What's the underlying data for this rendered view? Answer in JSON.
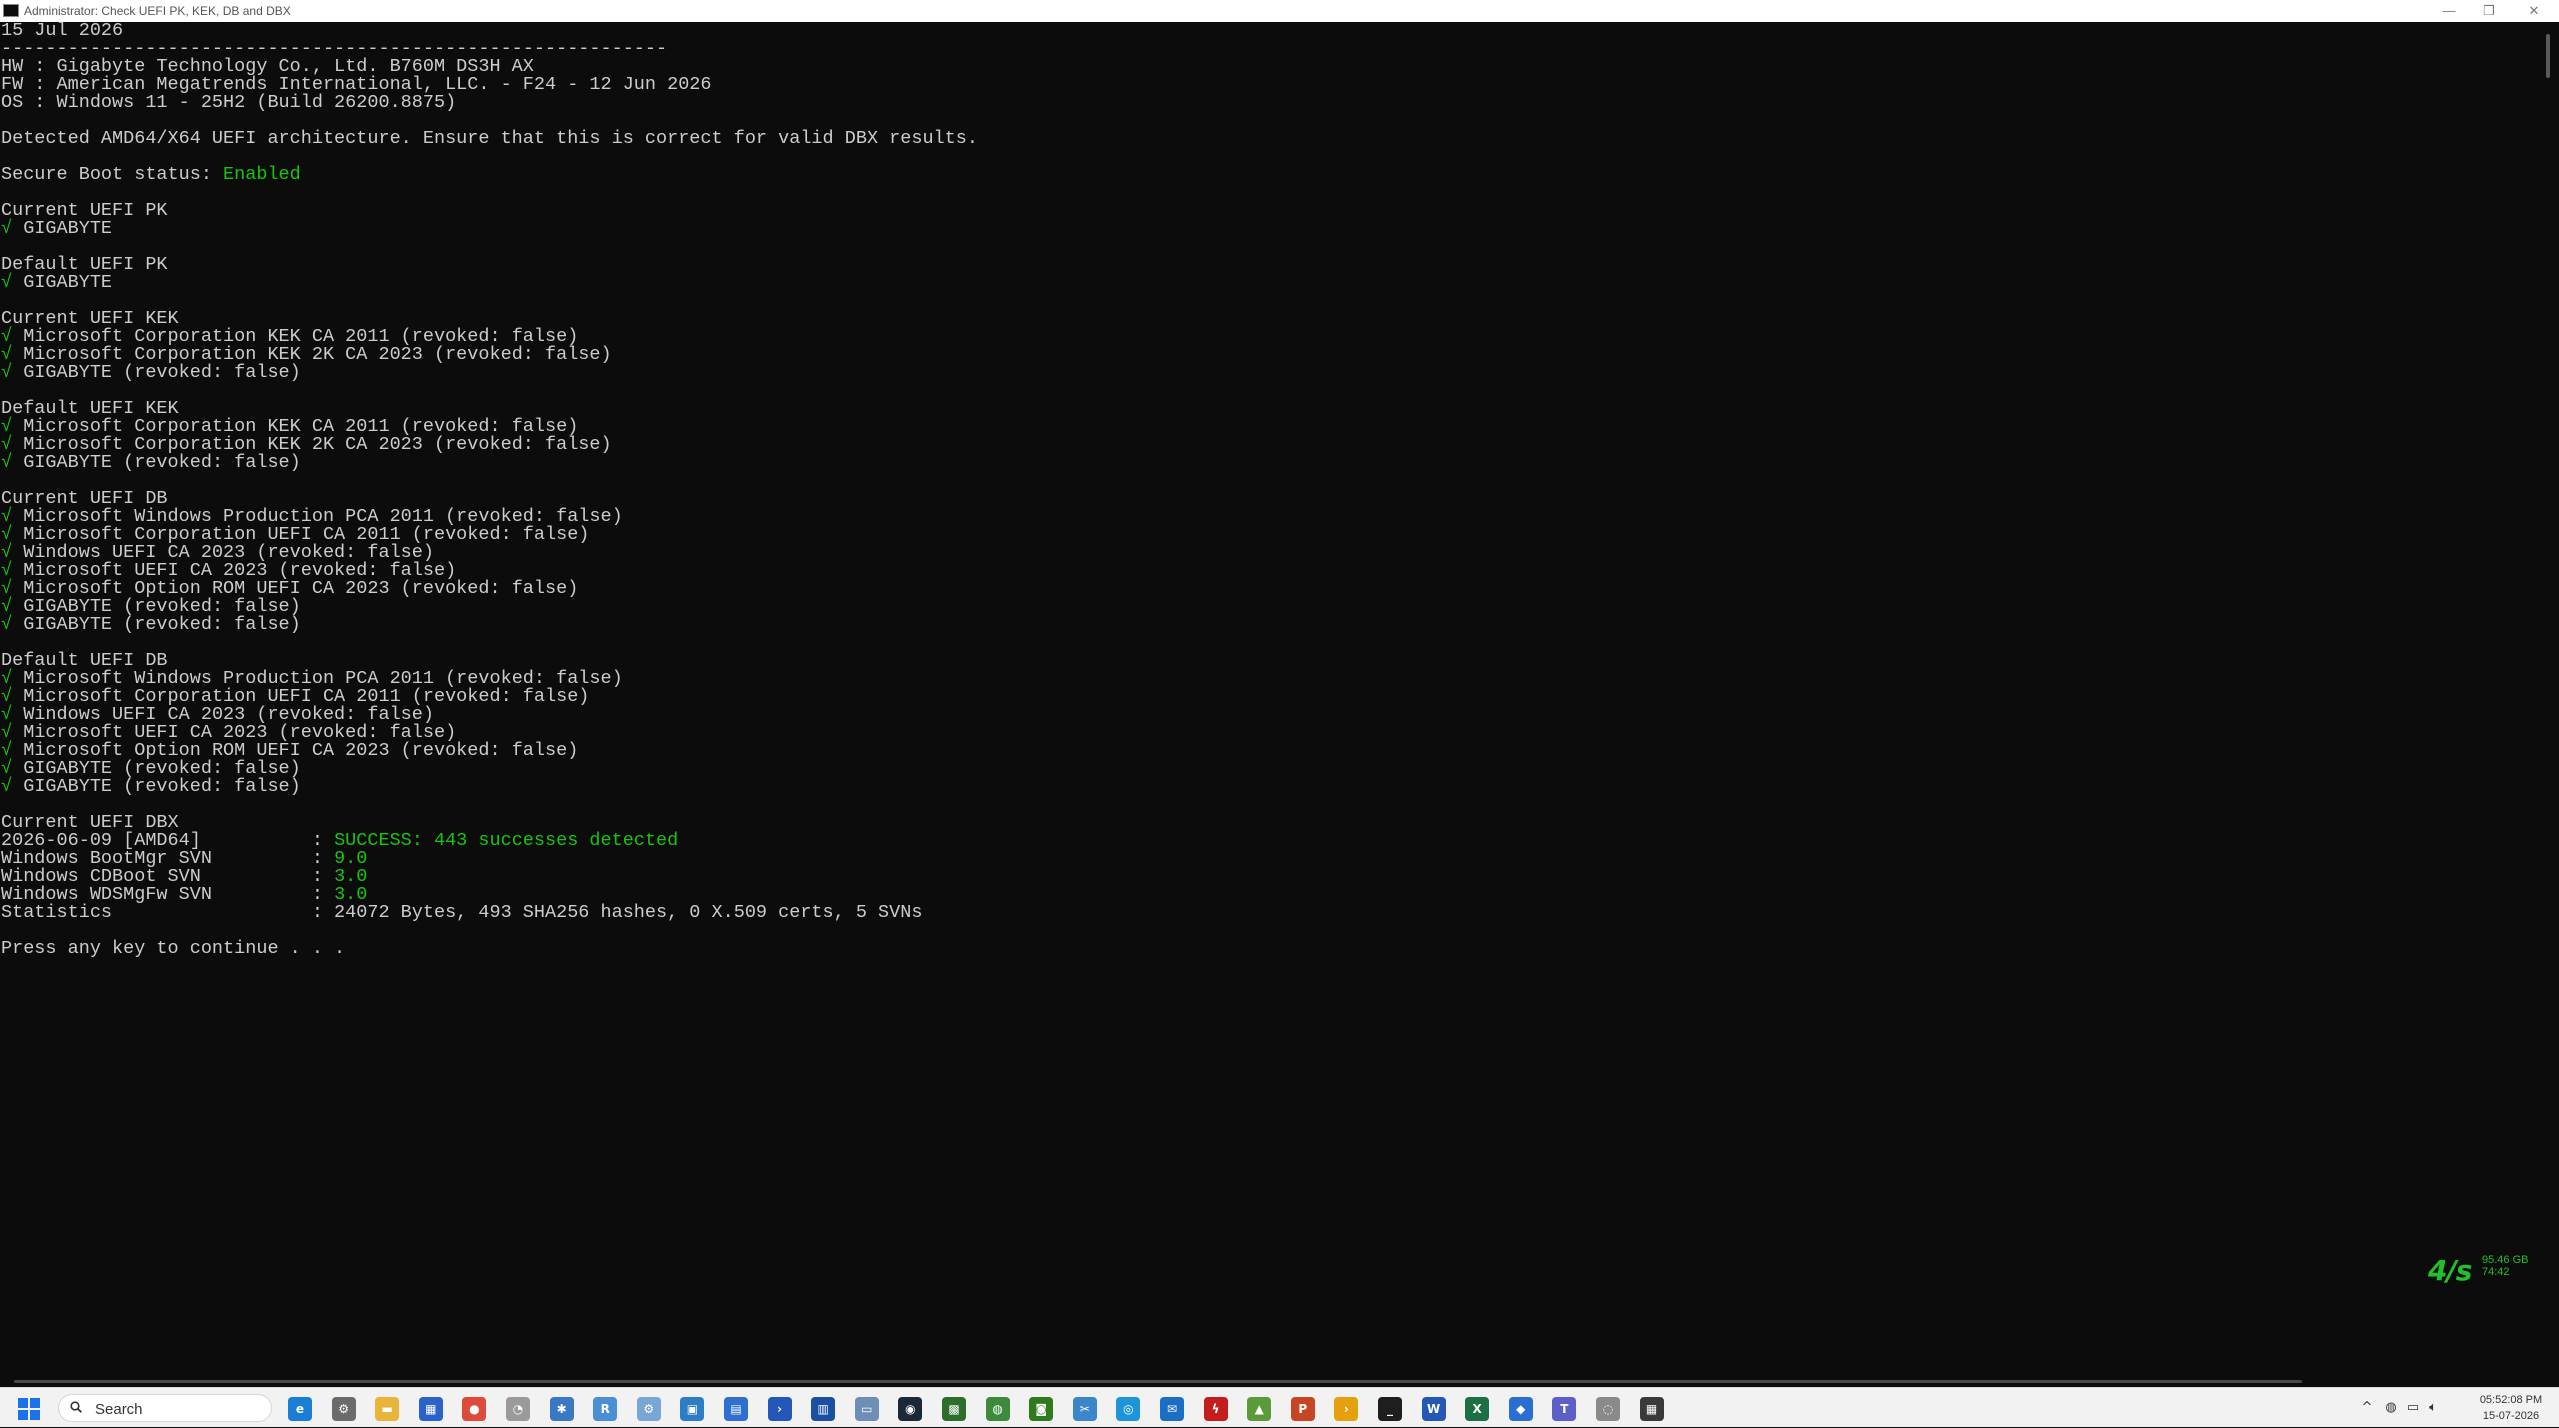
{
  "window": {
    "title": "Administrator: Check UEFI PK, KEK, DB and DBX",
    "minimize": "—",
    "maximize": "❐",
    "close": "✕"
  },
  "console": {
    "lines": [
      [
        {
          "t": "15 Jul 2026"
        }
      ],
      [
        {
          "t": "------------------------------------------------------------"
        }
      ],
      [
        {
          "t": "HW : Gigabyte Technology Co., Ltd. B760M DS3H AX"
        }
      ],
      [
        {
          "t": "FW : American Megatrends International, LLC. - F24 - 12 Jun 2026"
        }
      ],
      [
        {
          "t": "OS : Windows 11 - 25H2 (Build 26200.8875)"
        }
      ],
      [],
      [
        {
          "t": "Detected AMD64/X64 UEFI architecture. Ensure that this is correct for valid DBX results."
        }
      ],
      [],
      [
        {
          "t": "Secure Boot status: "
        },
        {
          "t": "Enabled",
          "c": "g"
        }
      ],
      [],
      [
        {
          "t": "Current UEFI PK"
        }
      ],
      [
        {
          "t": "√",
          "c": "check"
        },
        {
          "t": " GIGABYTE"
        }
      ],
      [],
      [
        {
          "t": "Default UEFI PK"
        }
      ],
      [
        {
          "t": "√",
          "c": "check"
        },
        {
          "t": " GIGABYTE"
        }
      ],
      [],
      [
        {
          "t": "Current UEFI KEK"
        }
      ],
      [
        {
          "t": "√",
          "c": "check"
        },
        {
          "t": " Microsoft Corporation KEK CA 2011 (revoked: false)"
        }
      ],
      [
        {
          "t": "√",
          "c": "check"
        },
        {
          "t": " Microsoft Corporation KEK 2K CA 2023 (revoked: false)"
        }
      ],
      [
        {
          "t": "√",
          "c": "check"
        },
        {
          "t": " GIGABYTE (revoked: false)"
        }
      ],
      [],
      [
        {
          "t": "Default UEFI KEK"
        }
      ],
      [
        {
          "t": "√",
          "c": "check"
        },
        {
          "t": " Microsoft Corporation KEK CA 2011 (revoked: false)"
        }
      ],
      [
        {
          "t": "√",
          "c": "check"
        },
        {
          "t": " Microsoft Corporation KEK 2K CA 2023 (revoked: false)"
        }
      ],
      [
        {
          "t": "√",
          "c": "check"
        },
        {
          "t": " GIGABYTE (revoked: false)"
        }
      ],
      [],
      [
        {
          "t": "Current UEFI DB"
        }
      ],
      [
        {
          "t": "√",
          "c": "check"
        },
        {
          "t": " Microsoft Windows Production PCA 2011 (revoked: false)"
        }
      ],
      [
        {
          "t": "√",
          "c": "check"
        },
        {
          "t": " Microsoft Corporation UEFI CA 2011 (revoked: false)"
        }
      ],
      [
        {
          "t": "√",
          "c": "check"
        },
        {
          "t": " Windows UEFI CA 2023 (revoked: false)"
        }
      ],
      [
        {
          "t": "√",
          "c": "check"
        },
        {
          "t": " Microsoft UEFI CA 2023 (revoked: false)"
        }
      ],
      [
        {
          "t": "√",
          "c": "check"
        },
        {
          "t": " Microsoft Option ROM UEFI CA 2023 (revoked: false)"
        }
      ],
      [
        {
          "t": "√",
          "c": "check"
        },
        {
          "t": " GIGABYTE (revoked: false)"
        }
      ],
      [
        {
          "t": "√",
          "c": "check"
        },
        {
          "t": " GIGABYTE (revoked: false)"
        }
      ],
      [],
      [
        {
          "t": "Default UEFI DB"
        }
      ],
      [
        {
          "t": "√",
          "c": "check"
        },
        {
          "t": " Microsoft Windows Production PCA 2011 (revoked: false)"
        }
      ],
      [
        {
          "t": "√",
          "c": "check"
        },
        {
          "t": " Microsoft Corporation UEFI CA 2011 (revoked: false)"
        }
      ],
      [
        {
          "t": "√",
          "c": "check"
        },
        {
          "t": " Windows UEFI CA 2023 (revoked: false)"
        }
      ],
      [
        {
          "t": "√",
          "c": "check"
        },
        {
          "t": " Microsoft UEFI CA 2023 (revoked: false)"
        }
      ],
      [
        {
          "t": "√",
          "c": "check"
        },
        {
          "t": " Microsoft Option ROM UEFI CA 2023 (revoked: false)"
        }
      ],
      [
        {
          "t": "√",
          "c": "check"
        },
        {
          "t": " GIGABYTE (revoked: false)"
        }
      ],
      [
        {
          "t": "√",
          "c": "check"
        },
        {
          "t": " GIGABYTE (revoked: false)"
        }
      ],
      [],
      [
        {
          "t": "Current UEFI DBX"
        }
      ],
      [
        {
          "t": "2026-06-09 [AMD64]          : "
        },
        {
          "t": "SUCCESS: 443 successes detected",
          "c": "g"
        }
      ],
      [
        {
          "t": "Windows BootMgr SVN         : "
        },
        {
          "t": "9.0",
          "c": "g"
        }
      ],
      [
        {
          "t": "Windows CDBoot SVN          : "
        },
        {
          "t": "3.0",
          "c": "g"
        }
      ],
      [
        {
          "t": "Windows WDSMgFw SVN         : "
        },
        {
          "t": "3.0",
          "c": "g"
        }
      ],
      [
        {
          "t": "Statistics                  : 24072 Bytes, 493 SHA256 hashes, 0 X.509 certs, 5 SVNs"
        }
      ],
      [],
      [
        {
          "t": "Press any key to continue . . ."
        }
      ]
    ]
  },
  "overlay": {
    "speed_label": "4/s",
    "line1": "95.46 GB",
    "line2": "74:42"
  },
  "taskbar": {
    "search_placeholder": "Search",
    "apps": [
      {
        "name": "edge-icon",
        "glyph": "e",
        "color": "#1a7fd4"
      },
      {
        "name": "settings-icon",
        "glyph": "⚙",
        "color": "#6b6b6b"
      },
      {
        "name": "file-explorer-icon",
        "glyph": "▬",
        "color": "#e8b53a"
      },
      {
        "name": "store-icon",
        "glyph": "▦",
        "color": "#2a62c9"
      },
      {
        "name": "chrome-icon",
        "glyph": "●",
        "color": "#dd4b39"
      },
      {
        "name": "clock-app-icon",
        "glyph": "◔",
        "color": "#9a9a9a"
      },
      {
        "name": "gear-app-icon",
        "glyph": "✱",
        "color": "#3b78c4"
      },
      {
        "name": "rdp-icon",
        "glyph": "R",
        "color": "#4a8fd6"
      },
      {
        "name": "network-icon",
        "glyph": "⚙",
        "color": "#78a7d6"
      },
      {
        "name": "photos-icon",
        "glyph": "▣",
        "color": "#2d7dc4"
      },
      {
        "name": "calculator-icon",
        "glyph": "▤",
        "color": "#2f6fcf"
      },
      {
        "name": "powershell-icon",
        "glyph": "›",
        "color": "#2357b8"
      },
      {
        "name": "hwinfo-icon",
        "glyph": "▥",
        "color": "#1b4fa3"
      },
      {
        "name": "monitor-icon",
        "glyph": "▭",
        "color": "#6e8fb5"
      },
      {
        "name": "steam-icon",
        "glyph": "◉",
        "color": "#1b2838"
      },
      {
        "name": "gpu-tool-icon",
        "glyph": "▩",
        "color": "#2c6e2c"
      },
      {
        "name": "globe-icon",
        "glyph": "◍",
        "color": "#3c8a3c"
      },
      {
        "name": "nvidia-icon",
        "glyph": "◙",
        "color": "#2f7a1a"
      },
      {
        "name": "snip-icon",
        "glyph": "✂",
        "color": "#3a86c8"
      },
      {
        "name": "copilot-icon",
        "glyph": "◎",
        "color": "#1d95d8"
      },
      {
        "name": "outlook-icon",
        "glyph": "✉",
        "color": "#1a6fc4"
      },
      {
        "name": "flash-icon",
        "glyph": "ϟ",
        "color": "#c41d1d"
      },
      {
        "name": "game-icon",
        "glyph": "▲",
        "color": "#5a9a3a"
      },
      {
        "name": "powerpoint-icon",
        "glyph": "P",
        "color": "#c64522"
      },
      {
        "name": "plex-icon",
        "glyph": "›",
        "color": "#e5a00d"
      },
      {
        "name": "terminal-icon",
        "glyph": "_",
        "color": "#1e1e1e"
      },
      {
        "name": "word-icon",
        "glyph": "W",
        "color": "#2359b5"
      },
      {
        "name": "excel-icon",
        "glyph": "X",
        "color": "#1d7044"
      },
      {
        "name": "defender-icon",
        "glyph": "◆",
        "color": "#2a6ed1"
      },
      {
        "name": "teams-icon",
        "glyph": "T",
        "color": "#5b5fc7"
      },
      {
        "name": "speedometer-icon",
        "glyph": "◌",
        "color": "#8a8a8a"
      },
      {
        "name": "hwmonitor-icon",
        "glyph": "▦",
        "color": "#3a3a3a"
      }
    ]
  },
  "tray": {
    "chevron": "^",
    "time": "05:52:08 PM",
    "date": "15-07-2026"
  },
  "colors": {
    "console_bg": "#0c0c0c",
    "console_fg": "#cccccc",
    "accent_green": "#16c60c"
  }
}
